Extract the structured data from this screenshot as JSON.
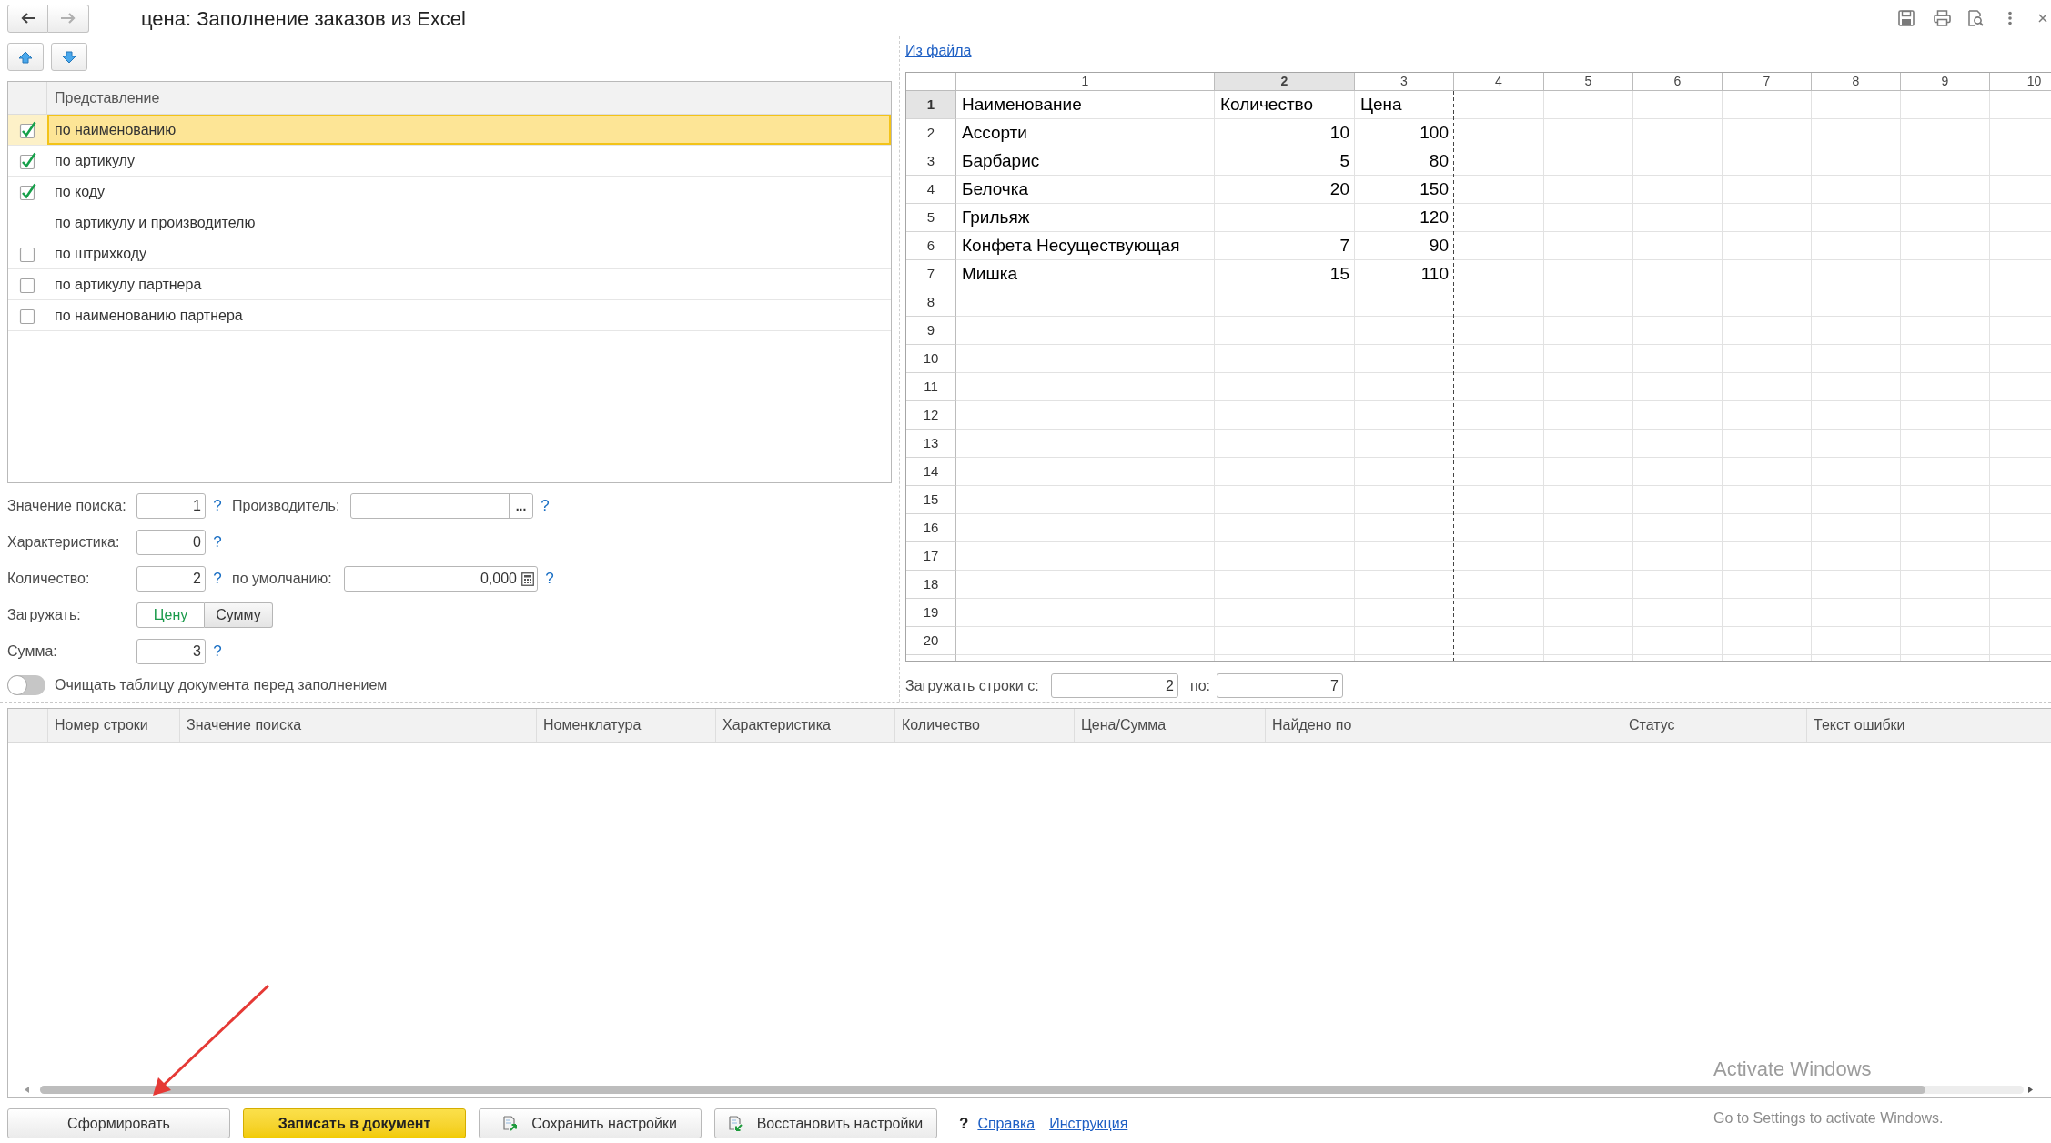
{
  "window": {
    "title": "цена: Заполнение заказов из Excel"
  },
  "nav": {
    "back": {
      "disabled": false
    },
    "forward": {
      "disabled": true
    }
  },
  "search_modes": {
    "column": "Представление",
    "rows": [
      {
        "label": "по наименованию",
        "kind": "checkbox",
        "checked": true,
        "selected": true
      },
      {
        "label": "по артикулу",
        "kind": "checkbox",
        "checked": true,
        "selected": false
      },
      {
        "label": "по коду",
        "kind": "checkbox",
        "checked": true,
        "selected": false
      },
      {
        "label": "по артикулу и производителю",
        "kind": "plain",
        "selected": false
      },
      {
        "label": "по штрихкоду",
        "kind": "checkbox",
        "checked": false,
        "selected": false
      },
      {
        "label": "по артикулу партнера",
        "kind": "checkbox",
        "checked": false,
        "selected": false
      },
      {
        "label": "по наименованию партнера",
        "kind": "checkbox",
        "checked": false,
        "selected": false
      }
    ]
  },
  "search_value": {
    "label": "Значение поиска:",
    "value": "1",
    "help": "?"
  },
  "manufacturer": {
    "label": "Производитель:",
    "button": "...",
    "help": "?"
  },
  "characteristic": {
    "label": "Характеристика:",
    "value": "0",
    "help": "?"
  },
  "quantity": {
    "label": "Количество:",
    "value": "2",
    "help": "?"
  },
  "default_quantity": {
    "label": "по умолчанию:",
    "value": "0,000",
    "help": "?"
  },
  "load_mode": {
    "label": "Загружать:",
    "options": [
      {
        "label": "Цену",
        "selected": true
      },
      {
        "label": "Сумму",
        "selected": false
      }
    ]
  },
  "sum": {
    "label": "Сумма:",
    "value": "3",
    "help": "?"
  },
  "clear_table": {
    "label": "Очищать таблицу документа перед заполнением",
    "on": false
  },
  "spreadsheet": {
    "link": "Из файла",
    "columns": [
      {
        "label": "1",
        "selected": false
      },
      {
        "label": "2",
        "selected": true
      },
      {
        "label": "3",
        "selected": false
      },
      {
        "label": "4",
        "selected": false
      },
      {
        "label": "5",
        "selected": false
      },
      {
        "label": "6",
        "selected": false
      },
      {
        "label": "7",
        "selected": false
      },
      {
        "label": "8",
        "selected": false
      },
      {
        "label": "9",
        "selected": false
      },
      {
        "label": "10",
        "selected": false
      }
    ],
    "rows": [
      {
        "label": "1",
        "selected": true,
        "numeric": false,
        "cells": [
          "Наименование",
          "Количество",
          "Цена"
        ]
      },
      {
        "label": "2",
        "selected": false,
        "numeric": true,
        "cells": [
          "Ассорти",
          "10",
          "100"
        ]
      },
      {
        "label": "3",
        "selected": false,
        "numeric": true,
        "cells": [
          "Барбарис",
          "5",
          "80"
        ]
      },
      {
        "label": "4",
        "selected": false,
        "numeric": true,
        "cells": [
          "Белочка",
          "20",
          "150"
        ]
      },
      {
        "label": "5",
        "selected": false,
        "numeric": true,
        "cells": [
          "Грильяж",
          null,
          "120"
        ]
      },
      {
        "label": "6",
        "selected": false,
        "numeric": true,
        "cells": [
          "Конфета Несуществующая",
          "7",
          "90"
        ]
      },
      {
        "label": "7",
        "selected": false,
        "numeric": true,
        "cells": [
          "Мишка",
          "15",
          "110"
        ]
      },
      {
        "label": "8",
        "selected": false
      },
      {
        "label": "9",
        "selected": false
      },
      {
        "label": "10",
        "selected": false
      },
      {
        "label": "11",
        "selected": false
      },
      {
        "label": "12",
        "selected": false
      },
      {
        "label": "13",
        "selected": false
      },
      {
        "label": "14",
        "selected": false
      },
      {
        "label": "15",
        "selected": false
      },
      {
        "label": "16",
        "selected": false
      },
      {
        "label": "17",
        "selected": false
      },
      {
        "label": "18",
        "selected": false
      },
      {
        "label": "19",
        "selected": false
      },
      {
        "label": "20",
        "selected": false
      }
    ]
  },
  "load_rows": {
    "label": "Загружать строки с:",
    "from": "2",
    "to_label": "по:",
    "to": "7"
  },
  "results_table": {
    "columns": [
      "Номер строки",
      "Значение поиска",
      "Номенклатура",
      "Характеристика",
      "Количество",
      "Цена/Сумма",
      "Найдено по",
      "Статус",
      "Текст ошибки"
    ]
  },
  "buttons": [
    {
      "label": "Сформировать",
      "kind": "default"
    },
    {
      "label": "Записать в документ",
      "kind": "primary"
    },
    {
      "label": "Сохранить настройки",
      "kind": "save"
    },
    {
      "label": "Восстановить настройки",
      "kind": "restore"
    }
  ],
  "help": {
    "mark": "?",
    "links": [
      "Справка",
      "Инструкция"
    ]
  },
  "system_notice": {
    "title": "Activate Windows",
    "text": "Go to Settings to activate Windows."
  }
}
